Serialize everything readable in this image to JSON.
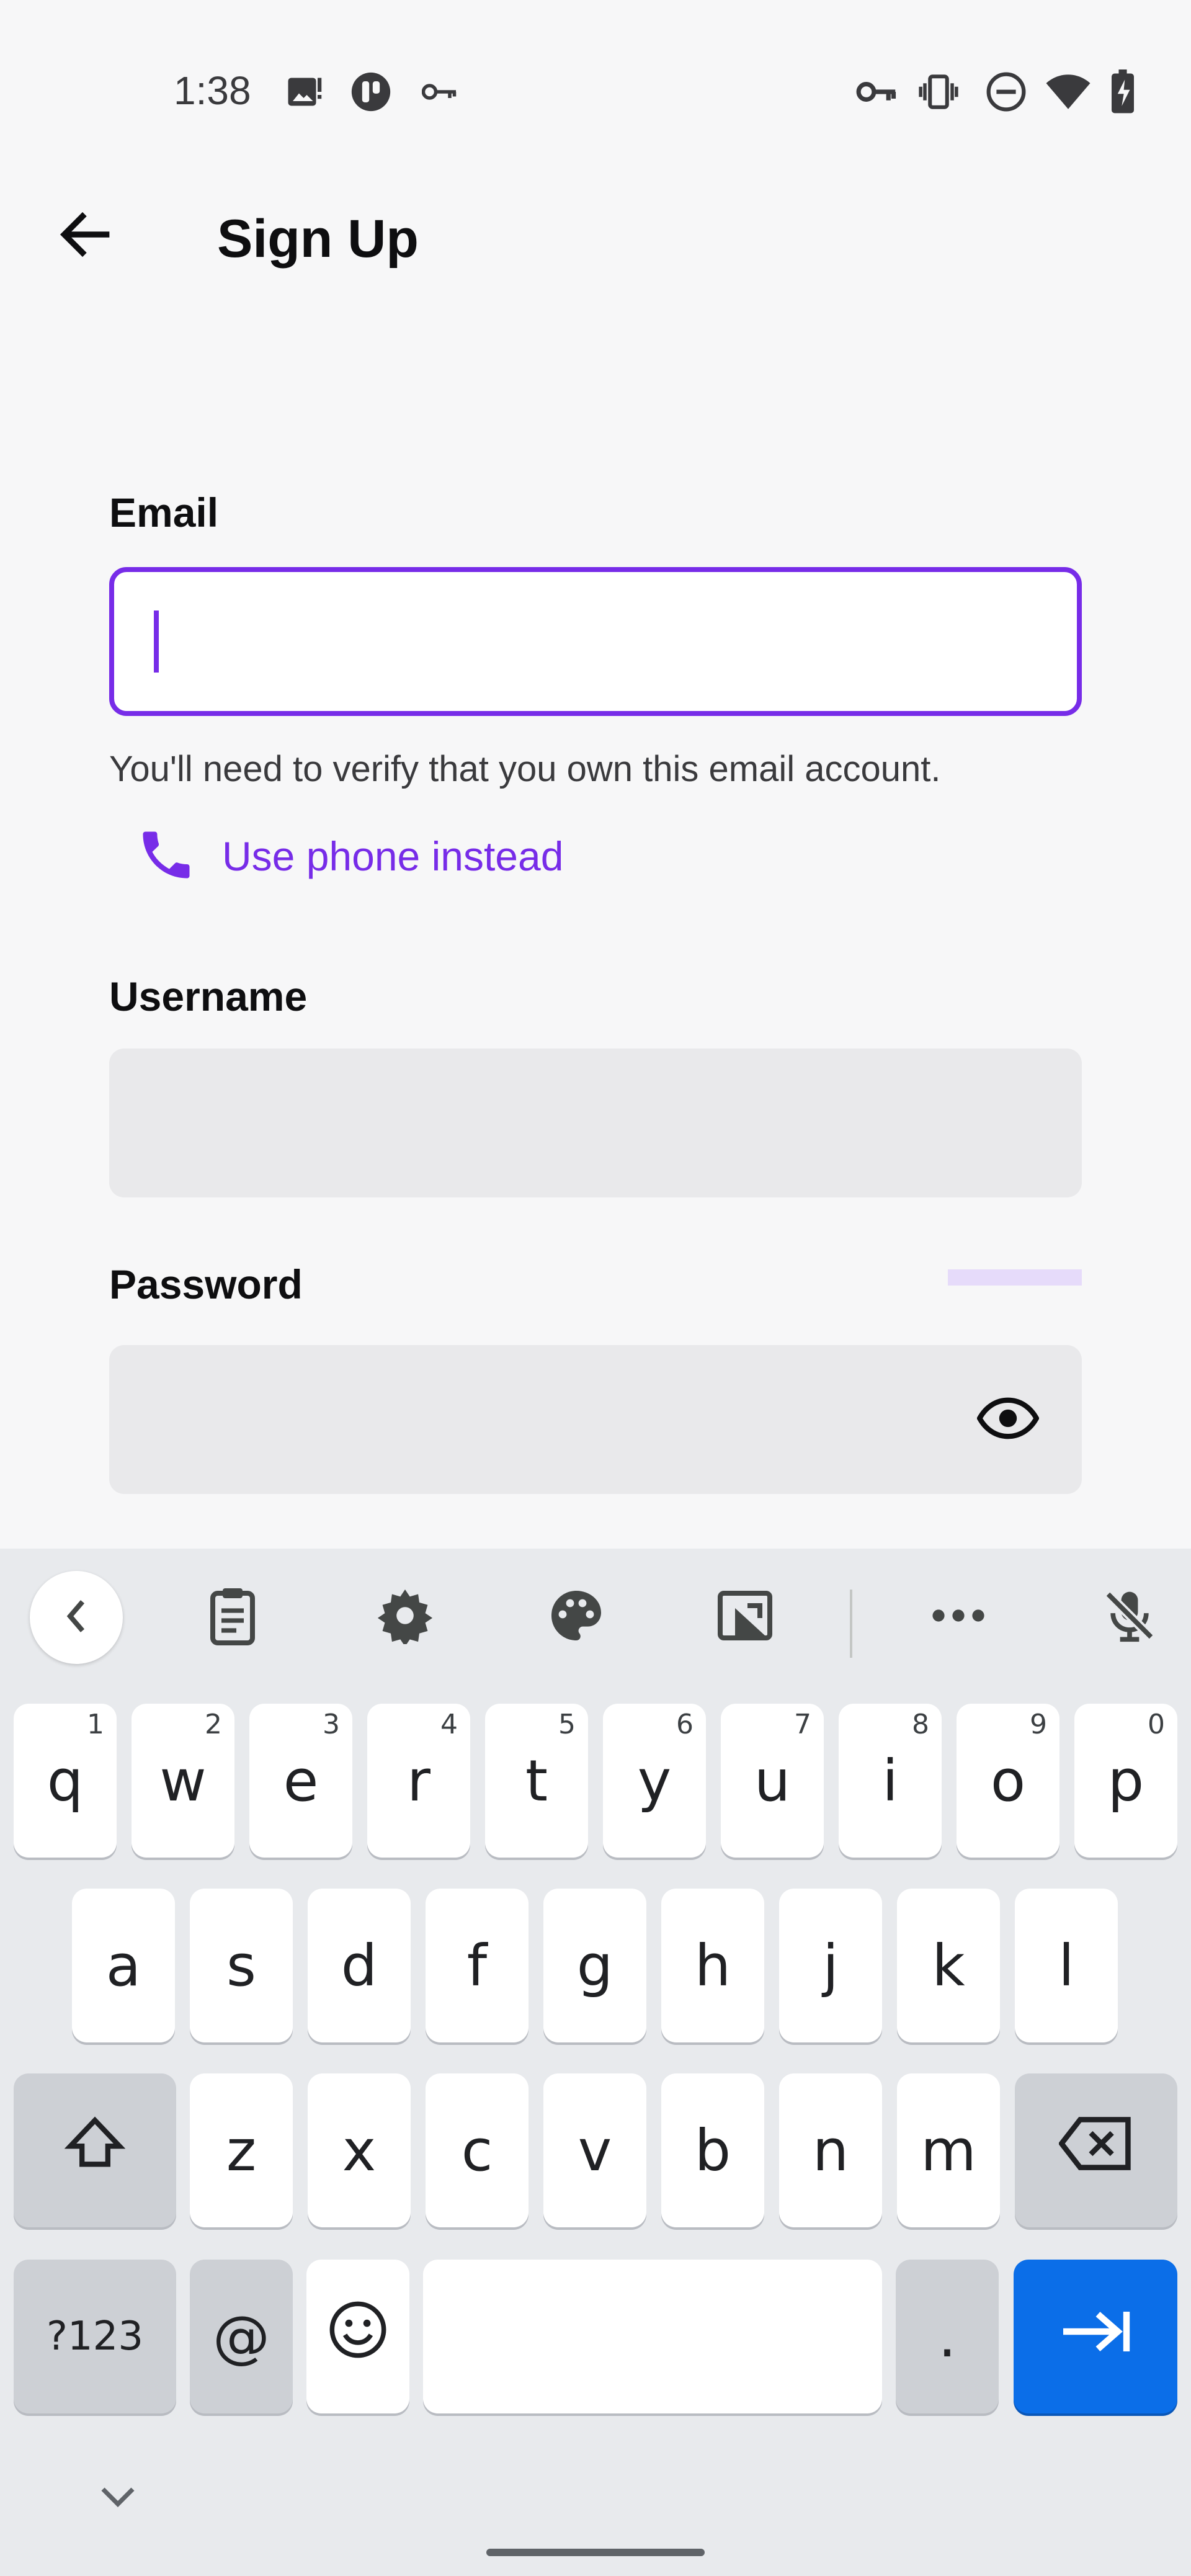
{
  "status_bar": {
    "time": "1:38",
    "left_icons": [
      "image-icon",
      "app-circle-icon",
      "key-icon"
    ],
    "right_icons": [
      "vpn-key-icon",
      "vibrate-icon",
      "do-not-disturb-icon",
      "wifi-icon",
      "battery-charging-icon"
    ]
  },
  "app_bar": {
    "title": "Sign Up",
    "back_icon": "arrow-left-icon"
  },
  "form": {
    "email": {
      "label": "Email",
      "value": "",
      "placeholder": "",
      "hint": "You'll need to verify that you own this email account."
    },
    "use_phone": {
      "label": "Use phone instead",
      "icon": "phone-icon"
    },
    "username": {
      "label": "Username",
      "value": "",
      "placeholder": ""
    },
    "password": {
      "label": "Password",
      "value": "",
      "placeholder": "",
      "toggle_icon": "eye-icon"
    }
  },
  "keyboard": {
    "toolbar": [
      "chevron-left-icon",
      "clipboard-icon",
      "gear-icon",
      "palette-icon",
      "image-crop-icon",
      "more-horiz-icon",
      "mic-off-icon"
    ],
    "row1": [
      {
        "key": "q",
        "hint": "1"
      },
      {
        "key": "w",
        "hint": "2"
      },
      {
        "key": "e",
        "hint": "3"
      },
      {
        "key": "r",
        "hint": "4"
      },
      {
        "key": "t",
        "hint": "5"
      },
      {
        "key": "y",
        "hint": "6"
      },
      {
        "key": "u",
        "hint": "7"
      },
      {
        "key": "i",
        "hint": "8"
      },
      {
        "key": "o",
        "hint": "9"
      },
      {
        "key": "p",
        "hint": "0"
      }
    ],
    "row2": [
      "a",
      "s",
      "d",
      "f",
      "g",
      "h",
      "j",
      "k",
      "l"
    ],
    "row3": [
      "z",
      "x",
      "c",
      "v",
      "b",
      "n",
      "m"
    ],
    "symbols_key": "?123",
    "at_key": "@",
    "period_key": ".",
    "space_key": "",
    "colors": {
      "enter": "#0b6ee8",
      "accent": "#772ce8"
    }
  }
}
